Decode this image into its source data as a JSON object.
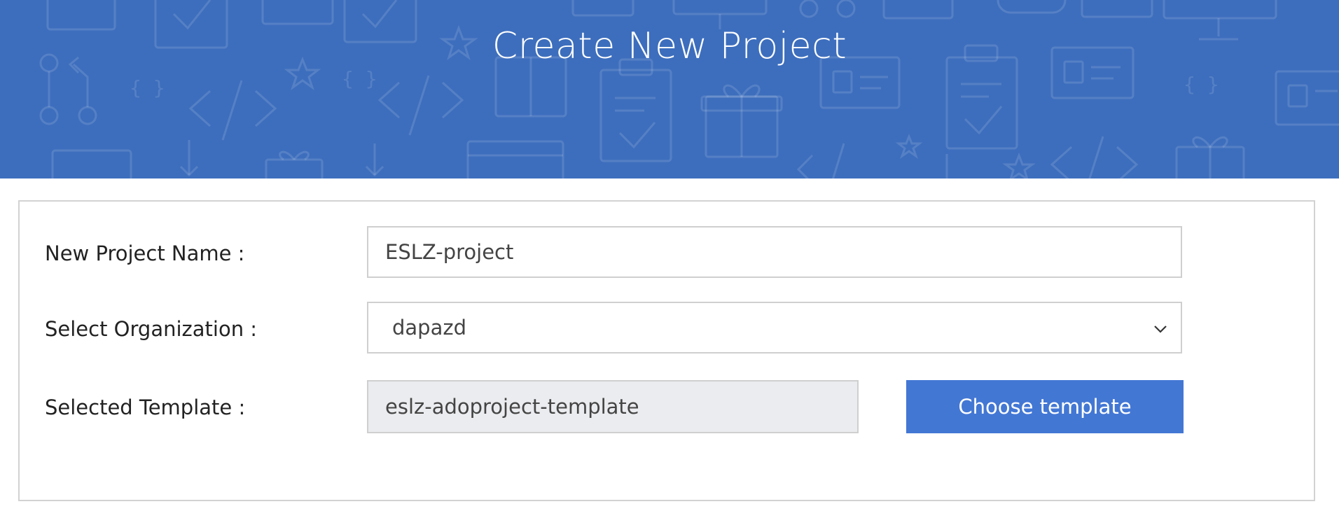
{
  "header": {
    "title": "Create New Project",
    "background_color": "#3d6ebd"
  },
  "form": {
    "project_name": {
      "label": "New Project Name :",
      "value": "ESLZ-project"
    },
    "organization": {
      "label": "Select Organization :",
      "selected": "dapazd",
      "icon": "chevron-down-icon"
    },
    "template": {
      "label": "Selected Template :",
      "value": "eslz-adoproject-template"
    },
    "choose_button": {
      "label": "Choose template",
      "color": "#4377d4"
    }
  }
}
